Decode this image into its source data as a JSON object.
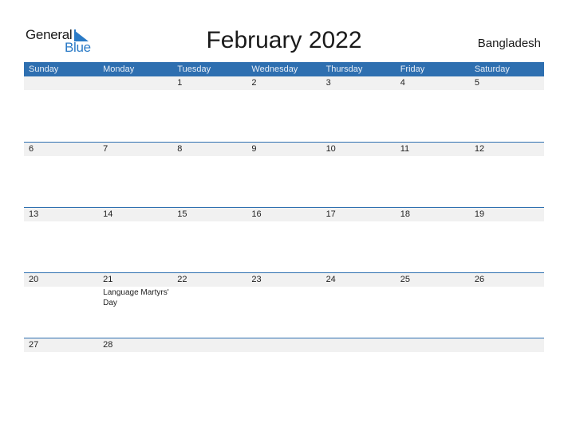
{
  "logo": {
    "general": "General",
    "blue": "Blue"
  },
  "title": "February 2022",
  "country": "Bangladesh",
  "colors": {
    "header_bg": "#2e6fb0",
    "accent": "#2a7ac6",
    "row_bg": "#f1f1f1"
  },
  "weekdays": [
    "Sunday",
    "Monday",
    "Tuesday",
    "Wednesday",
    "Thursday",
    "Friday",
    "Saturday"
  ],
  "weeks": [
    {
      "days": [
        "",
        "",
        "1",
        "2",
        "3",
        "4",
        "5"
      ],
      "events": [
        "",
        "",
        "",
        "",
        "",
        "",
        ""
      ]
    },
    {
      "days": [
        "6",
        "7",
        "8",
        "9",
        "10",
        "11",
        "12"
      ],
      "events": [
        "",
        "",
        "",
        "",
        "",
        "",
        ""
      ]
    },
    {
      "days": [
        "13",
        "14",
        "15",
        "16",
        "17",
        "18",
        "19"
      ],
      "events": [
        "",
        "",
        "",
        "",
        "",
        "",
        ""
      ]
    },
    {
      "days": [
        "20",
        "21",
        "22",
        "23",
        "24",
        "25",
        "26"
      ],
      "events": [
        "",
        "Language Martyrs' Day",
        "",
        "",
        "",
        "",
        ""
      ]
    },
    {
      "days": [
        "27",
        "28",
        "",
        "",
        "",
        "",
        ""
      ],
      "events": [
        "",
        "",
        "",
        "",
        "",
        "",
        ""
      ]
    }
  ]
}
